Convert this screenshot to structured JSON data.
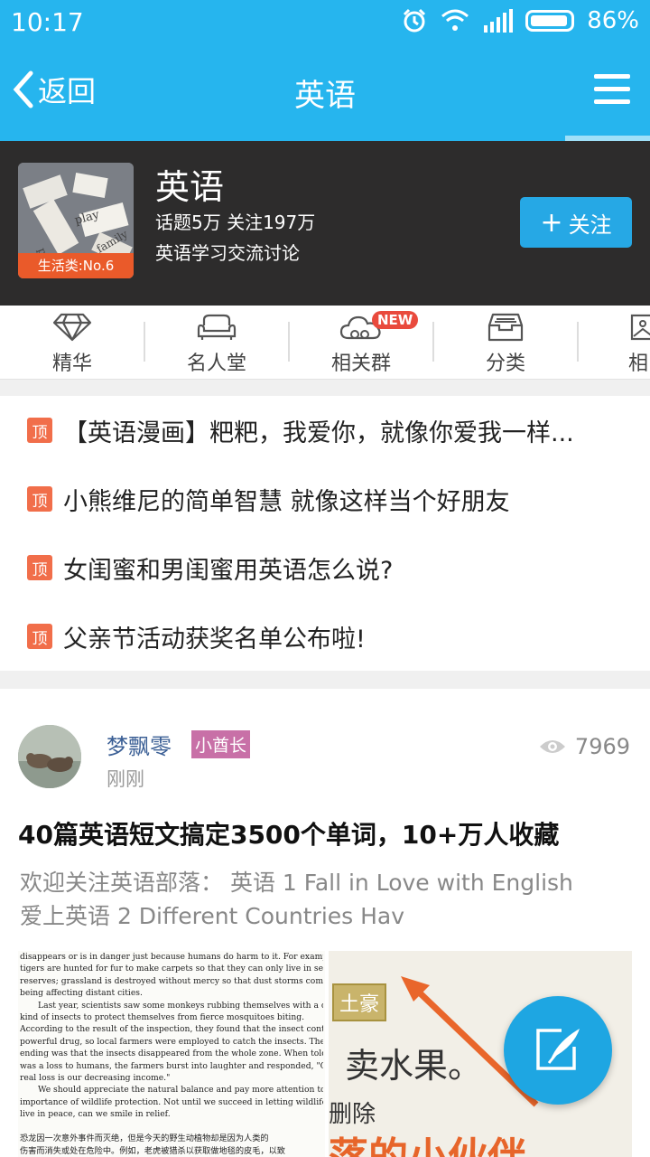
{
  "status_bar": {
    "time": "10:17",
    "battery": "86%",
    "icons": [
      "alarm-icon",
      "wifi-icon",
      "signal-icon",
      "battery-icon"
    ]
  },
  "nav": {
    "back_label": "返回",
    "title": "英语"
  },
  "header": {
    "name": "英语",
    "stats": "话题5万  关注197万",
    "description": "英语学习交流讨论",
    "avatar_badge": "生活类:No.6",
    "follow_label": "关注"
  },
  "tabs": [
    {
      "label": "精华",
      "icon": "diamond-icon"
    },
    {
      "label": "名人堂",
      "icon": "sofa-icon"
    },
    {
      "label": "相关群",
      "icon": "cloud-icon",
      "badge": "NEW"
    },
    {
      "label": "分类",
      "icon": "inbox-icon"
    },
    {
      "label": "相",
      "icon": "picture-icon"
    }
  ],
  "pinned": {
    "tag": "顶",
    "items": [
      "【英语漫画】粑粑，我爱你，就像你爱我一样...",
      "小熊维尼的简单智慧 就像这样当个好朋友",
      "女闺蜜和男闺蜜用英语怎么说?",
      "父亲节活动获奖名单公布啦!"
    ]
  },
  "post": {
    "author": "梦飘零",
    "role": "小酋长",
    "time": "刚刚",
    "views": "7969",
    "title": "40篇英语短文搞定3500个单词，10+万人收藏",
    "summary_line1": "欢迎关注英语部落： 英语 1 Fall in Love with English",
    "summary_line2": "爱上英语  2 Different Countries Hav",
    "image_left_lines": [
      "disappears or is in danger just because humans do harm to it. For example,",
      "tigers are hunted for fur to make carpets so that they can only live in secure",
      "reserves; grassland is destroyed without mercy so that dust storms come into",
      "being affecting distant cities.",
      "Last year, scientists saw some monkeys rubbing themselves with a certain",
      "kind of insects to protect themselves from fierce mosquitoes biting.",
      "According to the result of the inspection, they found that the insect contains a",
      "powerful drug, so local farmers were employed to catch the insects. The",
      "ending was that the insects disappeared from the whole zone. When told that it",
      "was a loss to humans, the farmers burst into laughter and responded, \"Our",
      "real loss is our decreasing income.\"",
      "We should appreciate the natural balance and pay more attention to the",
      "importance of wildlife protection. Not until we succeed in letting wildlife",
      "live in peace, can we smile in relief.",
      "",
      "恐龙因一次意外事件而灭绝，但是今天的野生动植物却是因为人类的",
      "伤害而消失或处在危险中。例如，老虎被猎杀以获取做地毯的皮毛，以致"
    ],
    "image_right": {
      "tag": "土豪",
      "text1": "卖水果。",
      "text2": "删除",
      "text3": "落的小伙伴"
    }
  }
}
